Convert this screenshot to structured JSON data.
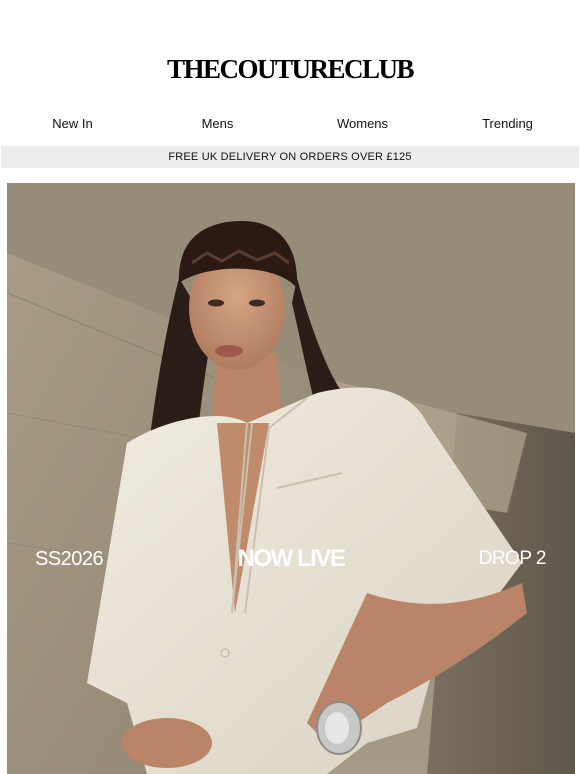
{
  "brand": {
    "logo_text": "THECOUTURECLUB"
  },
  "nav": {
    "items": [
      {
        "label": "New In"
      },
      {
        "label": "Mens"
      },
      {
        "label": "Womens"
      },
      {
        "label": "Trending"
      }
    ]
  },
  "banner": {
    "text": "FREE UK DELIVERY ON ORDERS OVER £125"
  },
  "hero": {
    "left_text": "SS2026",
    "center_text": "NOW LIVE",
    "right_text": "DROP 2"
  },
  "colors": {
    "banner_bg": "#ececec",
    "hero_text": "#ffffff",
    "concrete": "#9b917f"
  }
}
